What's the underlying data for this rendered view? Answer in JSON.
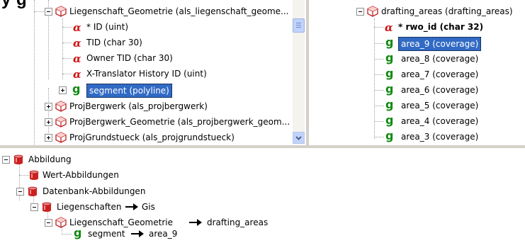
{
  "heading": "y        g",
  "left_tree": {
    "items": [
      {
        "label": "Liegenschaft_Geometrie (als_liegenschaft_geome..."
      },
      {
        "label": "* ID  (uint)"
      },
      {
        "label": "TID  (char 30)"
      },
      {
        "label": "Owner TID  (char 30)"
      },
      {
        "label": "X-Translator History ID  (uint)"
      },
      {
        "label": "segment  (polyline)"
      },
      {
        "label": "ProjBergwerk (als_projbergwerk)"
      },
      {
        "label": "ProjBergwerk_Geometrie (als_projbergwerk_geom..."
      },
      {
        "label": "ProjGrundstueck (als_projgrundstueck)"
      }
    ]
  },
  "right_tree": {
    "items": [
      {
        "label": "drafting_areas (drafting_areas)"
      },
      {
        "label": "* rwo_id  (char 32)"
      },
      {
        "label": "area_9  (coverage)"
      },
      {
        "label": "area_8  (coverage)"
      },
      {
        "label": "area_7  (coverage)"
      },
      {
        "label": "area_6  (coverage)"
      },
      {
        "label": "area_5  (coverage)"
      },
      {
        "label": "area_4  (coverage)"
      },
      {
        "label": "area_3  (coverage)"
      }
    ]
  },
  "mapping_tree": {
    "items": [
      {
        "label": "Abbildung"
      },
      {
        "label": "Wert-Abbildungen"
      },
      {
        "label": "Datenbank-Abbildungen"
      },
      {
        "source": "Liegenschaften",
        "target": "Gis"
      },
      {
        "source": "Liegenschaft_Geometrie",
        "target": "drafting_areas"
      },
      {
        "source": "segment",
        "target": "area_9"
      }
    ]
  },
  "icons": {
    "class_table": "red-cube-icon",
    "attribute": "alpha-attribute-icon",
    "geometry": "green-g-geometry-icon",
    "database": "red-cylinder-icon",
    "map_arrow": "arrow-right-icon"
  },
  "colors": {
    "selection": "#316ac5",
    "attribute_red": "#d01010",
    "geometry_green": "#108a10",
    "database_red": "#cc2020"
  }
}
